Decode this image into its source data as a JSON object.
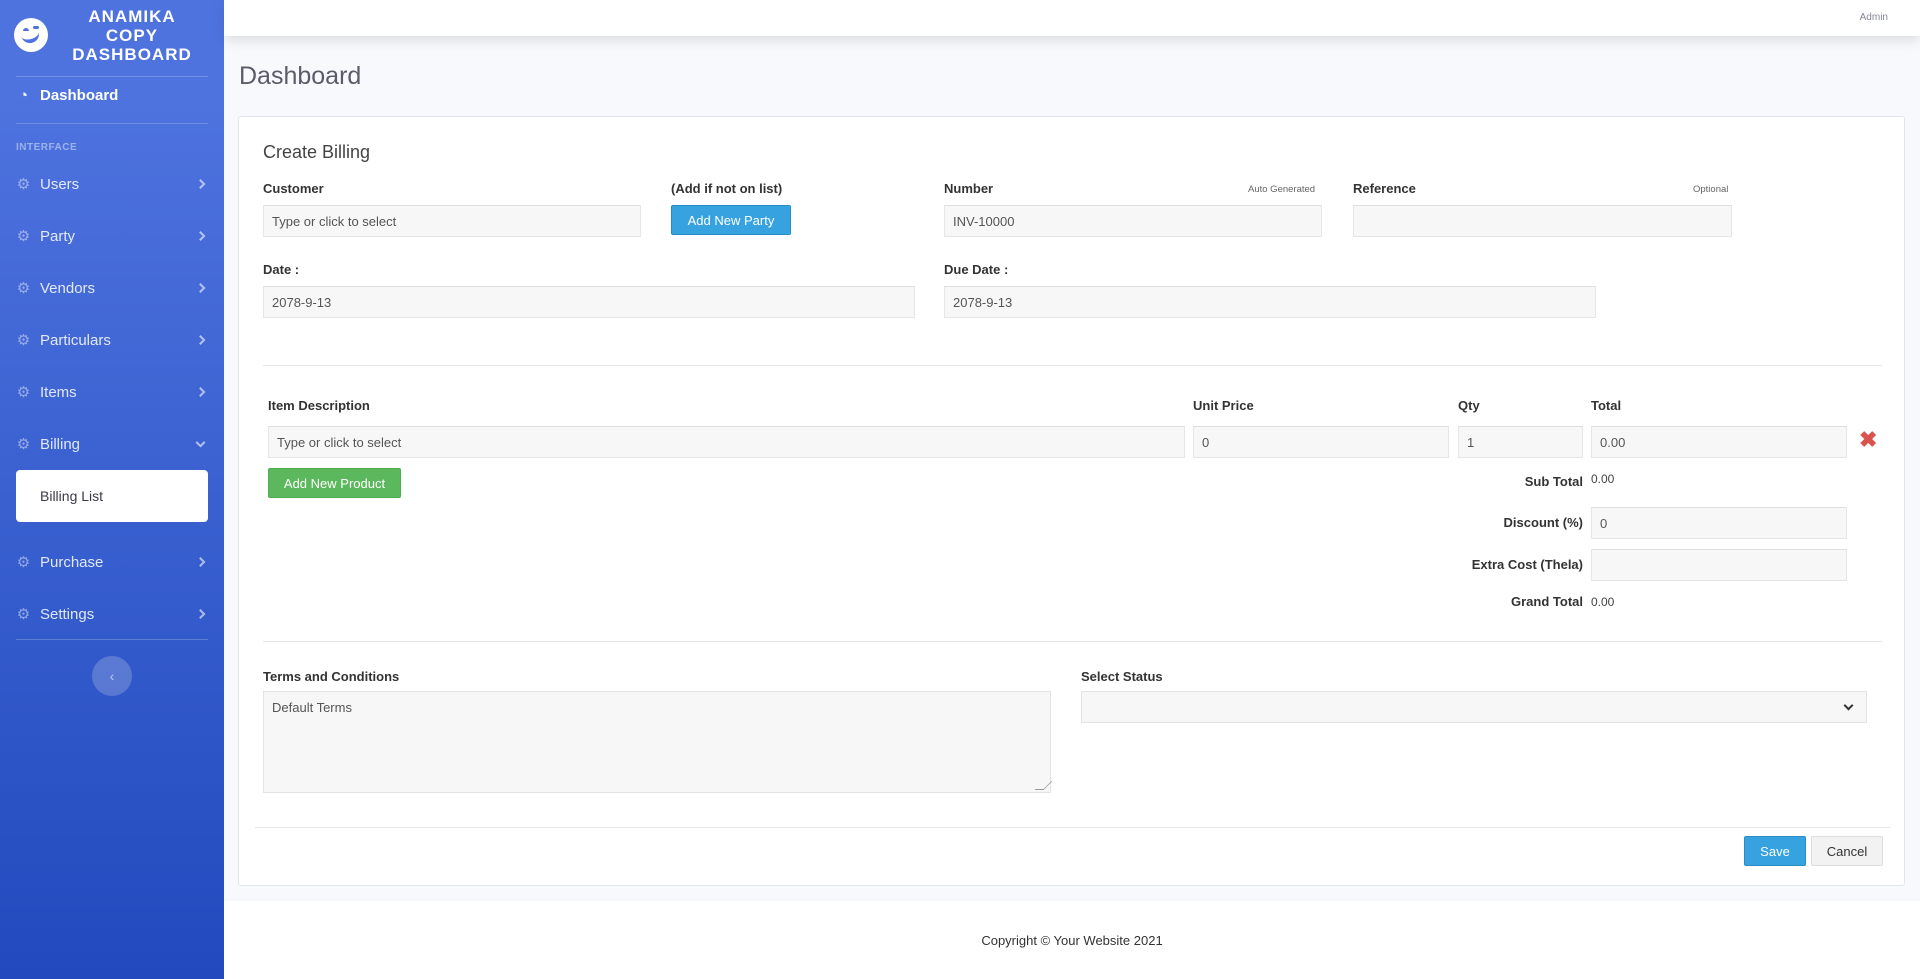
{
  "brand": {
    "title_line1": "ANAMIKA",
    "title_line2": "COPY",
    "title_line3": "DASHBOARD"
  },
  "sidebar": {
    "dashboard": "Dashboard",
    "heading": "INTERFACE",
    "items": [
      {
        "label": "Users"
      },
      {
        "label": "Party"
      },
      {
        "label": "Vendors"
      },
      {
        "label": "Particulars"
      },
      {
        "label": "Items"
      },
      {
        "label": "Billing"
      }
    ],
    "billing_sub": "Billing List",
    "items_after": [
      {
        "label": "Purchase"
      },
      {
        "label": "Settings"
      }
    ],
    "toggle": "‹"
  },
  "topbar": {
    "user": "Admin"
  },
  "page": {
    "title": "Dashboard"
  },
  "form": {
    "title": "Create Billing",
    "customer_label": "Customer",
    "customer_placeholder": "Type or click to select",
    "add_if_label": "(Add if not on list)",
    "add_party_button": "Add New Party",
    "number_label": "Number",
    "number_hint": "Auto Generated",
    "number_value": "INV-10000",
    "reference_label": "Reference",
    "reference_hint": "Optional",
    "reference_value": "",
    "date_label": "Date :",
    "date_value": "2078-9-13",
    "due_date_label": "Due Date :",
    "due_date_value": "2078-9-13",
    "item_desc_header": "Item Description",
    "unit_price_header": "Unit Price",
    "qty_header": "Qty",
    "total_header": "Total",
    "item_placeholder": "Type or click to select",
    "unit_price_value": "0",
    "qty_value": "1",
    "total_value": "0.00",
    "add_product_button": "Add New Product",
    "subtotal_label": "Sub Total",
    "subtotal_value": "0.00",
    "discount_label": "Discount (%)",
    "discount_value": "0",
    "extra_cost_label": "Extra Cost (Thela)",
    "extra_cost_value": "",
    "grand_total_label": "Grand Total",
    "grand_total_value": "0.00",
    "terms_label": "Terms and Conditions",
    "terms_value": "Default Terms",
    "status_label": "Select Status",
    "status_value": "",
    "save_button": "Save",
    "cancel_button": "Cancel"
  },
  "footer": {
    "copyright": "Copyright © Your Website 2021"
  }
}
